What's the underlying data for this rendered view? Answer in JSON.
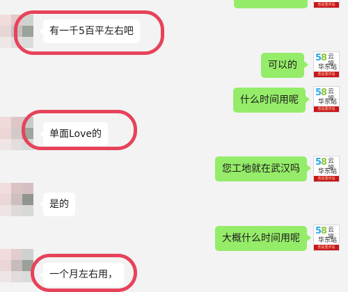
{
  "colors": {
    "sent_bubble": "#95ec69",
    "received_bubble": "#ffffff",
    "background": "#f3f3f3",
    "highlight_ring": "#e6435a"
  },
  "self_avatar": {
    "brand_number": "58",
    "brand_name": "云坡",
    "station": "华东站",
    "banner_text": "若是重庆站"
  },
  "messages": [
    {
      "side": "right",
      "text": "",
      "highlighted": false
    },
    {
      "side": "left",
      "text": "有一千5百平左右吧",
      "highlighted": true
    },
    {
      "side": "right",
      "text": "可以的",
      "highlighted": false
    },
    {
      "side": "right",
      "text": "什么时间用呢",
      "highlighted": false
    },
    {
      "side": "left",
      "text": "单面Love的",
      "highlighted": true
    },
    {
      "side": "right",
      "text": "您工地就在武汉吗",
      "highlighted": false
    },
    {
      "side": "left",
      "text": "是的",
      "highlighted": false
    },
    {
      "side": "right",
      "text": "大概什么时间用呢",
      "highlighted": false
    },
    {
      "side": "left",
      "text": "一个月左右用，",
      "highlighted": true
    }
  ]
}
